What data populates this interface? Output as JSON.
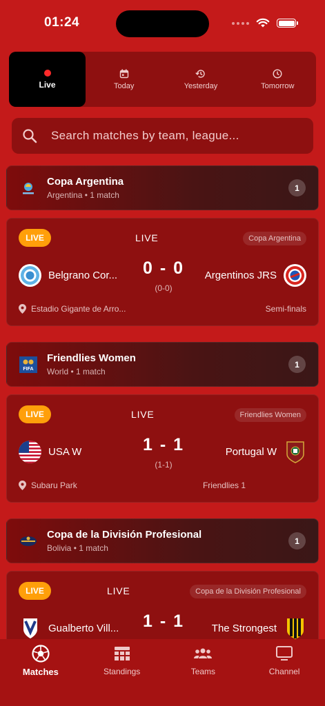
{
  "status_bar": {
    "time": "01:24"
  },
  "day_tabs": [
    {
      "label": "Live",
      "icon": "live-dot",
      "active": true
    },
    {
      "label": "Today",
      "icon": "calendar-icon"
    },
    {
      "label": "Yesterday",
      "icon": "history-icon"
    },
    {
      "label": "Tomorrow",
      "icon": "clock-icon"
    }
  ],
  "search": {
    "placeholder": "Search matches by team, league..."
  },
  "leagues": [
    {
      "name": "Copa Argentina",
      "country": "Argentina",
      "matches_text": "1 match",
      "count": "1",
      "match": {
        "badge": "LIVE",
        "status": "LIVE",
        "competition": "Copa Argentina",
        "home": "Belgrano Cor...",
        "away": "Argentinos JRS",
        "score": "0 - 0",
        "aggregate": "(0-0)",
        "venue": "Estadio Gigante de Arro...",
        "round": "Semi-finals"
      }
    },
    {
      "name": "Friendlies Women",
      "country": "World",
      "matches_text": "1 match",
      "count": "1",
      "match": {
        "badge": "LIVE",
        "status": "LIVE",
        "competition": "Friendlies Women",
        "home": "USA W",
        "away": "Portugal W",
        "score": "1 - 1",
        "aggregate": "(1-1)",
        "venue": "Subaru Park",
        "round": "Friendlies 1"
      }
    },
    {
      "name": "Copa de la División Profesional",
      "country": "Bolivia",
      "matches_text": "1 match",
      "count": "1",
      "match": {
        "badge": "LIVE",
        "status": "LIVE",
        "competition": "Copa de la División Profesional",
        "home": "Gualberto Vill...",
        "away": "The Strongest",
        "score": "1 - 1"
      }
    }
  ],
  "bottom_nav": [
    {
      "label": "Matches",
      "icon": "soccer-ball-icon",
      "active": true
    },
    {
      "label": "Standings",
      "icon": "table-icon"
    },
    {
      "label": "Teams",
      "icon": "people-icon"
    },
    {
      "label": "Channel",
      "icon": "tv-icon"
    }
  ],
  "colors": {
    "background": "#c41a1a",
    "card": "#8e1010",
    "live_badge": "#ff9f0a",
    "live_dot": "#ff2a2a"
  }
}
